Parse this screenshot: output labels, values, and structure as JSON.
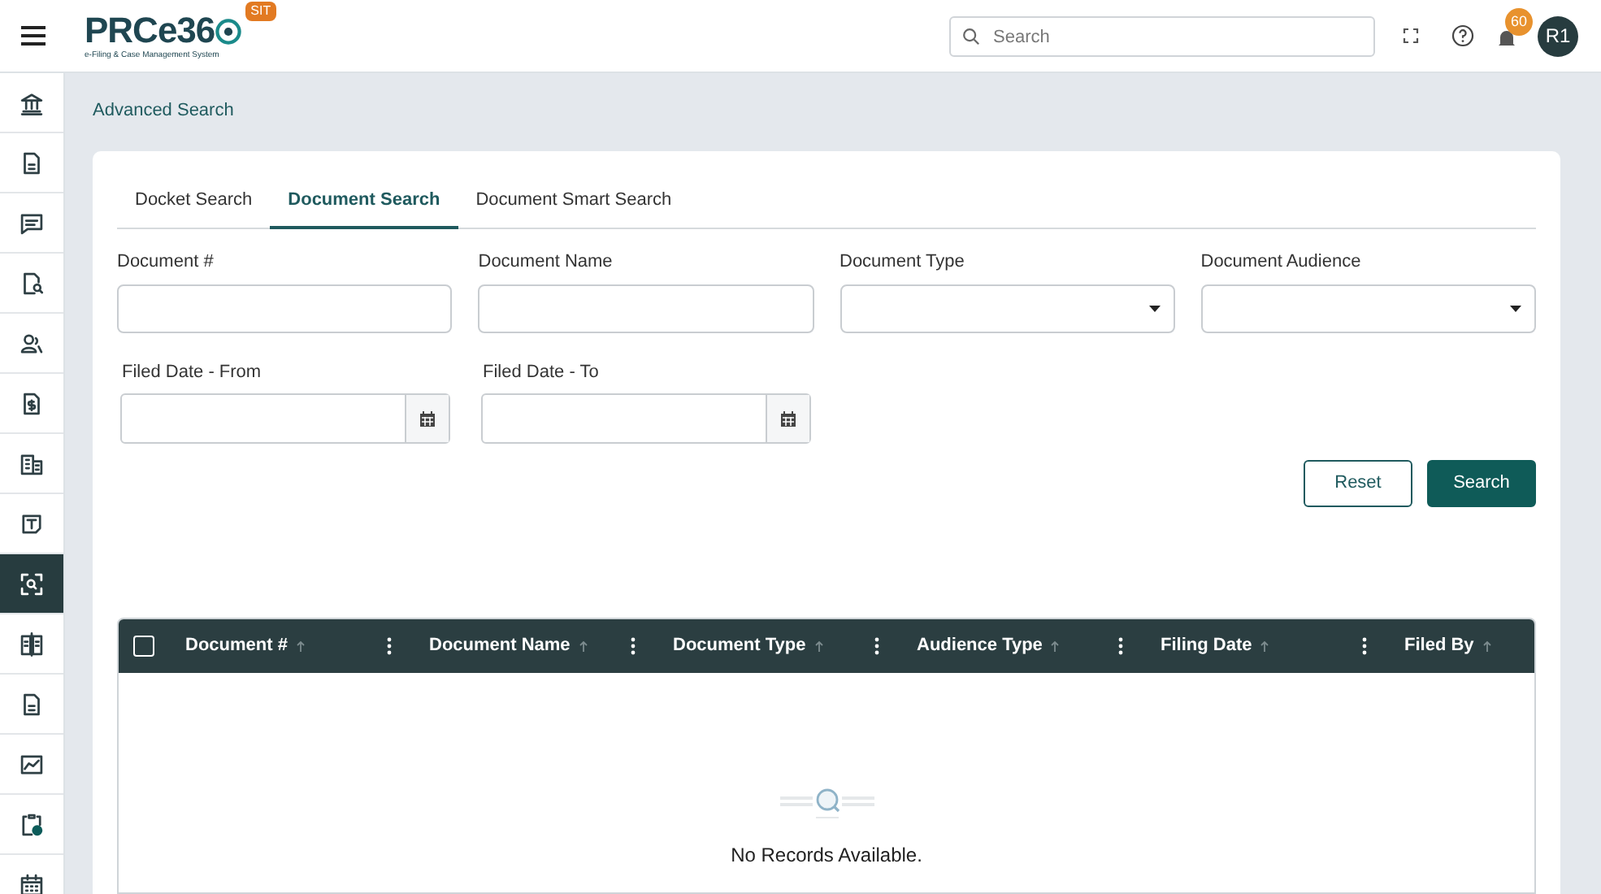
{
  "header": {
    "logo_text": "PRCe36",
    "logo_tagline": "e-Filing & Case Management System",
    "env_badge": "SIT",
    "search": {
      "placeholder": "Search"
    },
    "notification_count": "60",
    "avatar": "R1"
  },
  "sidebar": {
    "items": [
      {
        "selected": false
      },
      {
        "selected": false
      },
      {
        "selected": false
      },
      {
        "selected": false
      },
      {
        "selected": false
      },
      {
        "selected": false
      },
      {
        "selected": false
      },
      {
        "selected": false
      },
      {
        "selected": true
      },
      {
        "selected": false
      },
      {
        "selected": false
      },
      {
        "selected": false
      },
      {
        "selected": false
      },
      {
        "selected": false
      }
    ]
  },
  "breadcrumb": "Advanced Search",
  "tabs": [
    {
      "label": "Docket Search",
      "selected": false
    },
    {
      "label": "Document Search",
      "selected": true
    },
    {
      "label": "Document Smart Search",
      "selected": false
    }
  ],
  "fields": [
    {
      "label": "Document #",
      "kind": "text"
    },
    {
      "label": "Document Name",
      "kind": "text"
    },
    {
      "label": "Document Type",
      "kind": "select"
    },
    {
      "label": "Document Audience",
      "kind": "select"
    },
    {
      "label": "Filed Date - From",
      "kind": "date"
    },
    {
      "label": "Filed Date - To",
      "kind": "date"
    }
  ],
  "buttons": [
    {
      "label": "Reset",
      "kind": "outline"
    },
    {
      "label": "Search",
      "kind": "primary"
    }
  ],
  "table": {
    "select_all_checked": false,
    "columns": [
      {
        "label": "Document #",
        "menu": true
      },
      {
        "label": "Document Name",
        "menu": true
      },
      {
        "label": "Document Type",
        "menu": true
      },
      {
        "label": "Audience Type",
        "menu": true
      },
      {
        "label": "Filing Date",
        "menu": true
      },
      {
        "label": "Filed By",
        "menu": false
      }
    ],
    "empty_message": "No Records Available."
  }
}
